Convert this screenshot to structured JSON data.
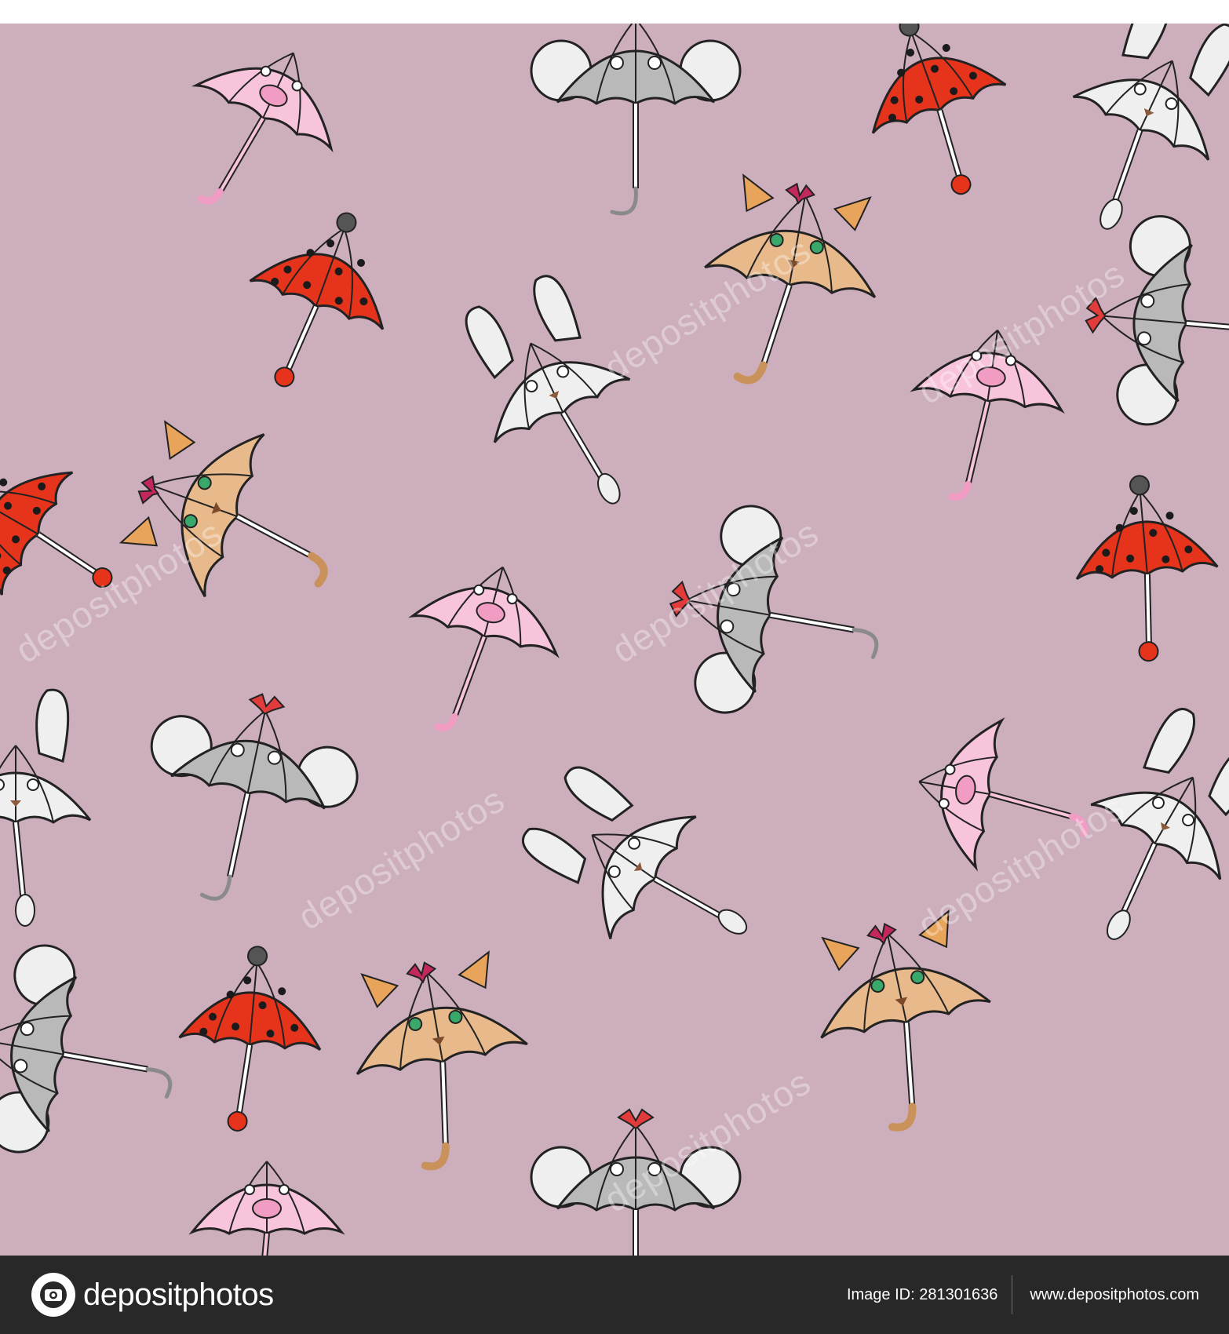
{
  "image": {
    "description_colors": {
      "background": "#cdaebd",
      "pig": "#f7c4dc",
      "cat": "#e8b98a",
      "mouse": "#b9b9b9",
      "ladybug": "#e5341b",
      "bunny": "#efefef"
    }
  },
  "watermark": {
    "text": "depositphotos"
  },
  "footer": {
    "brand": "depositphotos",
    "image_id": "Image ID: 281301636",
    "website": "www.depositphotos.com"
  }
}
